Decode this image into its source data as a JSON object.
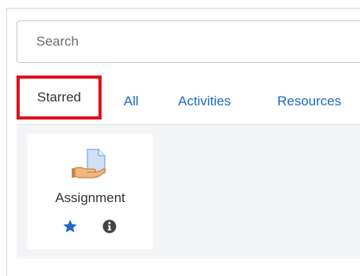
{
  "search": {
    "placeholder": "Search"
  },
  "tabs": [
    {
      "label": "Starred",
      "active": true,
      "highlighted": true
    },
    {
      "label": "All"
    },
    {
      "label": "Activities"
    },
    {
      "label": "Resources"
    }
  ],
  "cards": [
    {
      "label": "Assignment",
      "icon": "assignment-icon",
      "actions": [
        {
          "icon": "star-icon",
          "starred": true
        },
        {
          "icon": "info-icon"
        }
      ]
    }
  ],
  "colors": {
    "link": "#1f69c7",
    "highlight_border": "#e0101a",
    "star": "#1f69c7",
    "content_background": "#f4f5f7"
  }
}
